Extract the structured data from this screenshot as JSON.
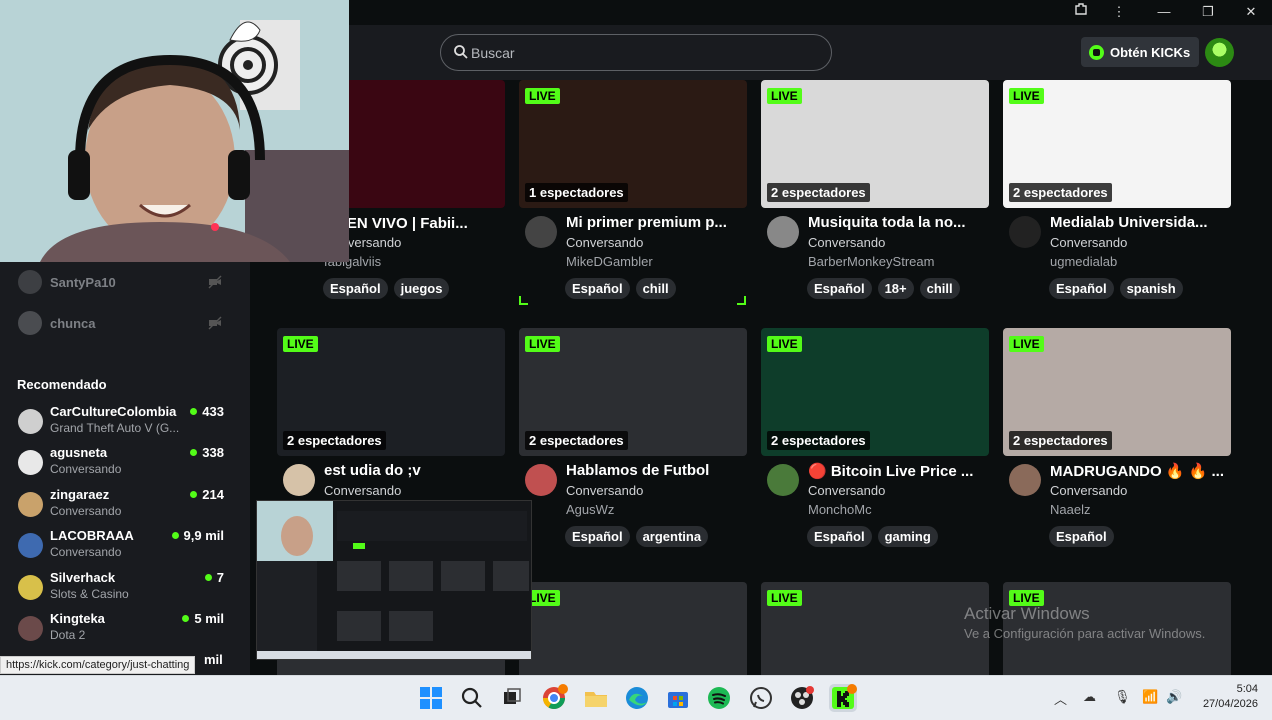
{
  "search": {
    "placeholder": "Buscar"
  },
  "header": {
    "kicks_label": "Obtén KICKs"
  },
  "sidebar": {
    "following": [
      {
        "name": "SantyPa10"
      },
      {
        "name": "chunca"
      }
    ],
    "recommended_title": "Recomendado",
    "recommended": [
      {
        "name": "CarCultureColombia",
        "category": "Grand Theft Auto V (G...",
        "viewers": "433",
        "color": "#cfcfcf"
      },
      {
        "name": "agusneta",
        "category": "Conversando",
        "viewers": "338",
        "color": "#e8e8e8"
      },
      {
        "name": "zingaraez",
        "category": "Conversando",
        "viewers": "214",
        "color": "#c9a26b"
      },
      {
        "name": "LACOBRAAA",
        "category": "Conversando",
        "viewers": "9,9 mil",
        "color": "#3e6ab0"
      },
      {
        "name": "Silverhack",
        "category": "Slots & Casino",
        "viewers": "7",
        "color": "#d8c04a"
      },
      {
        "name": "Kingteka",
        "category": "Dota 2",
        "viewers": "5 mil",
        "color": "#6b4a4a"
      }
    ],
    "partial_viewers": "mil"
  },
  "live_label": "LIVE",
  "cards": [
    {
      "title": "🔴 EN VIVO | Fabii...",
      "category": "Conversando",
      "channel": "fabigalviis",
      "viewers": "...adores",
      "tags": [
        "Español",
        "juegos"
      ],
      "thumb": "#3a0612",
      "avatar": "#b31b3b"
    },
    {
      "title": "Mi primer premium p...",
      "category": "Conversando",
      "channel": "MikeDGambler",
      "viewers": "1 espectadores",
      "tags": [
        "Español",
        "chill"
      ],
      "thumb": "#2b1a14",
      "avatar": "#444"
    },
    {
      "title": "Musiquita toda la no...",
      "category": "Conversando",
      "channel": "BarberMonkeyStream",
      "viewers": "2 espectadores",
      "tags": [
        "Español",
        "18+",
        "chill"
      ],
      "thumb": "#d9d9d9",
      "avatar": "#888"
    },
    {
      "title": "Medialab Universida...",
      "category": "Conversando",
      "channel": "ugmedialab",
      "viewers": "2 espectadores",
      "tags": [
        "Español",
        "spanish"
      ],
      "thumb": "#f4f4f4",
      "avatar": "#222"
    },
    {
      "title": "est udia do ;v",
      "category": "Conversando",
      "channel": "",
      "viewers": "2 espectadores",
      "tags": [],
      "thumb": "#1c1f24",
      "avatar": "#d6c2a8"
    },
    {
      "title": "Hablamos de Futbol",
      "category": "Conversando",
      "channel": "AgusWz",
      "viewers": "2 espectadores",
      "tags": [
        "Español",
        "argentina"
      ],
      "thumb": "#2c2e32",
      "avatar": "#c05050"
    },
    {
      "title": "🔴 Bitcoin Live Price ...",
      "category": "Conversando",
      "channel": "MonchoMc",
      "viewers": "2 espectadores",
      "tags": [
        "Español",
        "gaming"
      ],
      "thumb": "#0e3d2a",
      "avatar": "#4a7a3a"
    },
    {
      "title": "MADRUGANDO 🔥 🔥 ...",
      "category": "Conversando",
      "channel": "Naaelz",
      "viewers": "2 espectadores",
      "tags": [
        "Español"
      ],
      "thumb": "#b5aaa5",
      "avatar": "#8a6a5a"
    },
    {
      "viewers": "",
      "thumb": "#2c2e32"
    },
    {
      "viewers": "",
      "thumb": "#2c2e32"
    },
    {
      "viewers": "",
      "thumb": "#2c2e32"
    },
    {
      "viewers": "",
      "thumb": "#2c2e32"
    }
  ],
  "watermark": {
    "line1": "Activar Windows",
    "line2": "Ve a Configuración para activar Windows."
  },
  "status_url": "https://kick.com/category/just-chatting",
  "clock": {
    "time": "5:04",
    "date": "27/04/2026"
  },
  "colors": {
    "accent": "#53fc18",
    "bg": "#0b0e0f",
    "panel": "#191b1f"
  }
}
